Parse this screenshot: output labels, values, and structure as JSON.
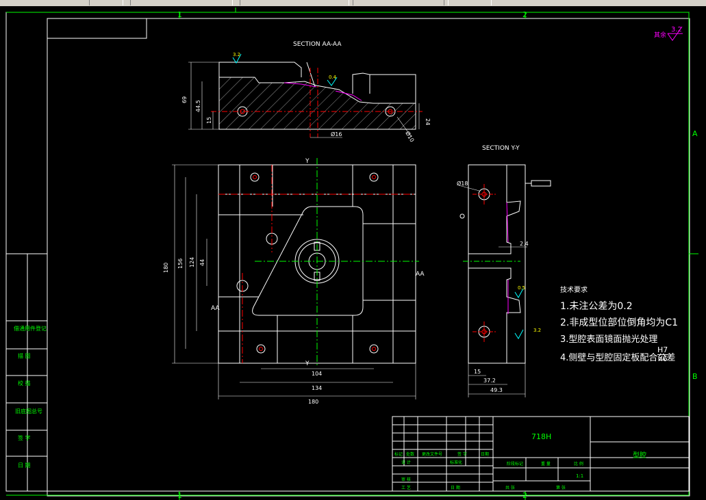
{
  "toolbar": {
    "items": [
      "",
      "",
      "",
      ""
    ]
  },
  "border": {
    "top_numbers": [
      "1",
      "2"
    ],
    "bottom_numbers": [
      "1",
      "2"
    ],
    "side_letters": [
      "A",
      "B"
    ]
  },
  "roughness": {
    "label": "其余",
    "value": "3.2"
  },
  "sections": {
    "aa_title": "SECTION AA-AA",
    "yy_title": "SECTION Y-Y",
    "cut_y": "Y",
    "cut_aa": "AA"
  },
  "dimensions": {
    "aa_height": "69",
    "aa_h2": "44.5",
    "aa_h3": "15",
    "aa_h4": "24",
    "aa_hole": "Ø16",
    "aa_dia10": "Ø10",
    "aa_rough1": "3.2",
    "aa_rough2": "0.4",
    "plan_v1": "180",
    "plan_v2": "156",
    "plan_v3": "124",
    "plan_v4": "44",
    "plan_h1": "104",
    "plan_h2": "134",
    "plan_h3": "180",
    "yy_dia": "Ø18",
    "yy_24": "2.4",
    "yy_r1": "0.5",
    "yy_r2": "3.2",
    "yy_15": "15",
    "yy_372": "37.2",
    "yy_493": "49.3"
  },
  "notes": {
    "title": "技术要求",
    "line1": "1.未注公差为0.2",
    "line2": "2.非成型位部位倒角均为C1",
    "line3": "3.型腔表面镜面抛光处理",
    "line4": "4.侧壁与型腔固定板配合公差",
    "fit_top": "H7",
    "fit_bottom": "n6"
  },
  "left_strip": [
    "借通用件登记",
    "描 图",
    "校 描",
    "旧底图总号",
    "签 字",
    "日 期"
  ],
  "title_block": {
    "material": "718H",
    "part_name": "型腔",
    "row_labels": [
      "标记",
      "处数",
      "更改文件号",
      "签 字",
      "日期"
    ],
    "design": "设 计",
    "standard": "标准化",
    "stage": "阶段标记",
    "weight": "重 量",
    "scale": "比 例",
    "scale_value": "1:1",
    "check": "审 核",
    "process": "工 艺",
    "date": "日 期",
    "sheet": "共 张",
    "sheet2": "第 张"
  }
}
